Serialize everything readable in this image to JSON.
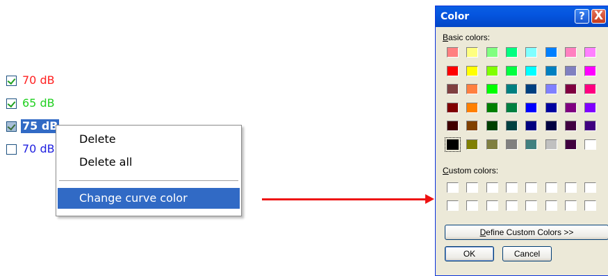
{
  "curves": [
    {
      "label": "70 dB",
      "color": "#ff2020",
      "checked": true,
      "selected": false
    },
    {
      "label": "65 dB",
      "color": "#20d020",
      "checked": true,
      "selected": false
    },
    {
      "label": "75 dB",
      "color": "#ffffff",
      "checked": true,
      "selected": true
    },
    {
      "label": "70 dB",
      "color": "#2020e0",
      "checked": false,
      "selected": false
    }
  ],
  "context_menu": {
    "items": [
      {
        "label": "Delete"
      },
      {
        "label": "Delete all"
      },
      {
        "label": "Change curve color"
      }
    ],
    "highlighted_index": 2
  },
  "color_dialog": {
    "title": "Color",
    "help_glyph": "?",
    "close_glyph": "X",
    "basic_colors_label": "Basic colors:",
    "custom_colors_label": "Custom colors:",
    "define_custom_button": "Define Custom Colors >>",
    "ok_button": "OK",
    "cancel_button": "Cancel",
    "basic_colors": [
      [
        "#ff8080",
        "#ffff80",
        "#80ff80",
        "#00ff80",
        "#80ffff",
        "#0080ff",
        "#ff80c0",
        "#ff80ff"
      ],
      [
        "#ff0000",
        "#ffff00",
        "#80ff00",
        "#00ff40",
        "#00ffff",
        "#0080c0",
        "#8080c0",
        "#ff00ff"
      ],
      [
        "#804040",
        "#ff8040",
        "#00ff00",
        "#008080",
        "#004080",
        "#8080ff",
        "#800040",
        "#ff0080"
      ],
      [
        "#800000",
        "#ff8000",
        "#008000",
        "#008040",
        "#0000ff",
        "#0000a0",
        "#800080",
        "#8000ff"
      ],
      [
        "#400000",
        "#804000",
        "#004000",
        "#004040",
        "#000080",
        "#000040",
        "#400040",
        "#400080"
      ],
      [
        "#000000",
        "#808000",
        "#808040",
        "#808080",
        "#408080",
        "#c0c0c0",
        "#400040",
        "#ffffff"
      ]
    ],
    "selected_color": "#000000",
    "custom_colors": [
      [
        "#ffffff",
        "#ffffff",
        "#ffffff",
        "#ffffff",
        "#ffffff",
        "#ffffff",
        "#ffffff",
        "#ffffff"
      ],
      [
        "#ffffff",
        "#ffffff",
        "#ffffff",
        "#ffffff",
        "#ffffff",
        "#ffffff",
        "#ffffff",
        "#ffffff"
      ]
    ]
  },
  "arrow_color": "#ee1111"
}
